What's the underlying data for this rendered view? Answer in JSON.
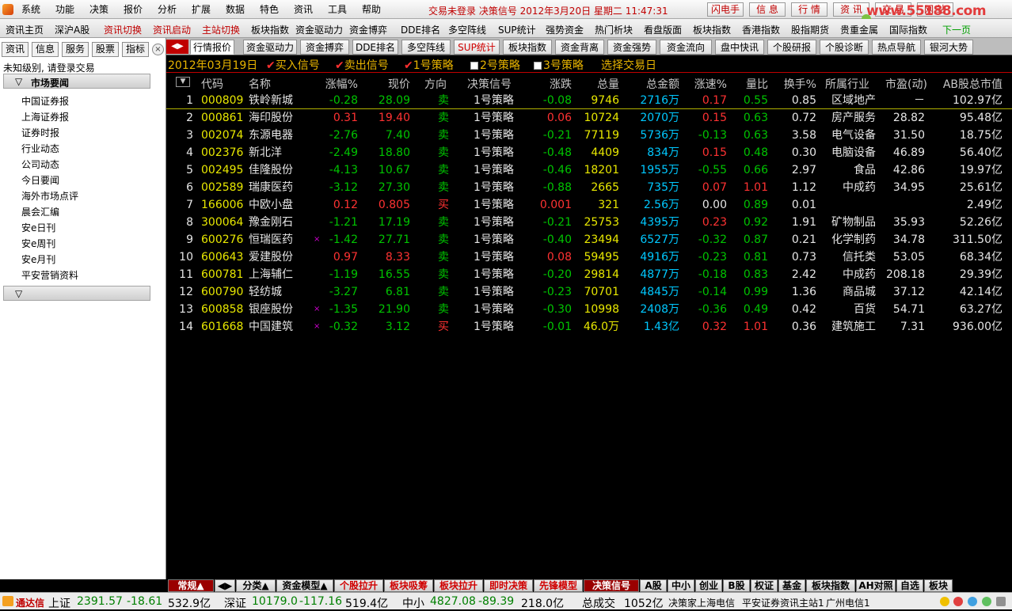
{
  "menu": [
    "系统",
    "功能",
    "决策",
    "报价",
    "分析",
    "扩展",
    "数据",
    "特色",
    "资讯",
    "工具",
    "帮助"
  ],
  "status_text": "交易未登录 决策信号 2012年3月20日 星期二 11:47:31",
  "window_buttons": [
    "闪电手",
    "信 息",
    "行 情",
    "资 讯",
    "交 易",
    "网 站"
  ],
  "watermark": "www.55188.com",
  "toolbar": [
    {
      "label": "资讯主页",
      "color": "#000000"
    },
    {
      "label": "深沪A股",
      "color": "#000000"
    },
    {
      "label": "资讯切换",
      "color": "#c00000"
    },
    {
      "label": "资讯启动",
      "color": "#c00000"
    },
    {
      "label": "主站切换",
      "color": "#c00000"
    },
    {
      "label": "板块指数",
      "color": "#000000"
    },
    {
      "label": "资金驱动力",
      "color": "#000000"
    },
    {
      "label": "资金博弈",
      "color": "#000000"
    },
    {
      "label": "DDE排名",
      "color": "#000000"
    },
    {
      "label": "多空阵线",
      "color": "#000000"
    },
    {
      "label": "SUP统计",
      "color": "#000000"
    },
    {
      "label": "强势资金",
      "color": "#000000"
    },
    {
      "label": "热门析块",
      "color": "#000000"
    },
    {
      "label": "看盘版面",
      "color": "#000000"
    },
    {
      "label": "板块指数",
      "color": "#000000"
    },
    {
      "label": "香港指数",
      "color": "#000000"
    },
    {
      "label": "股指期货",
      "color": "#000000"
    },
    {
      "label": "贵重金属",
      "color": "#000000"
    },
    {
      "label": "国际指数",
      "color": "#000000"
    },
    {
      "label": "下一页",
      "color": "#00a000"
    }
  ],
  "sidebar": {
    "tabs": [
      "资讯",
      "信息",
      "服务",
      "股票",
      "指标"
    ],
    "close": "×",
    "login_text": "未知级别, 请登录交易",
    "section1_arrow": "▽",
    "section1_title": "市场要闻",
    "items": [
      "中国证券报",
      "上海证券报",
      "证券时报",
      "行业动态",
      "公司动态",
      "今日要闻",
      "海外市场点评",
      "晨会汇编",
      "安e日刊",
      "安e周刊",
      "安e月刊",
      "平安营销资料"
    ],
    "section2_arrow": "▽"
  },
  "tabs": {
    "arrows": "◀▶",
    "labels": [
      "行情报价",
      "资金驱动力",
      "资金搏弈",
      "DDE排名",
      "多空阵线",
      "SUP统计",
      "板块指数",
      "资金背离",
      "资金强势",
      "资金流向",
      "盘中快讯",
      "个股研报",
      "个股诊断",
      "热点导航",
      "银河大势"
    ],
    "active_index": 0,
    "red_index": 5
  },
  "filter": {
    "date": "2012年03月19日",
    "buy_signal": "买入信号",
    "sell_signal": "卖出信号",
    "strategy1": "1号策略",
    "strategy2": "2号策略",
    "strategy3": "3号策略",
    "select_day": "选择交易日",
    "check_glyph": "✔"
  },
  "table": {
    "sort_glyph": "▼",
    "columns": [
      "代码",
      "名称",
      "涨幅%",
      "现价",
      "方向",
      "决策信号",
      "涨跌",
      "总量",
      "总金额",
      "涨速%",
      "量比",
      "换手%",
      "所属行业",
      "市盈(动)",
      "AB股总市值"
    ],
    "rows": [
      {
        "n": "1",
        "code": "000809",
        "name": "铁岭新城",
        "mark": "",
        "chg": "-0.28",
        "price": "28.09",
        "dir": "卖",
        "sig": "1号策略",
        "diff": "-0.08",
        "vol": "9746",
        "amt": "2716万",
        "speed": "0.17",
        "lb": "0.55",
        "turn": "0.85",
        "ind": "区域地产",
        "pe": "－",
        "mv": "102.97亿"
      },
      {
        "n": "2",
        "code": "000861",
        "name": "海印股份",
        "mark": "",
        "chg": "0.31",
        "price": "19.40",
        "dir": "卖",
        "sig": "1号策略",
        "diff": "0.06",
        "vol": "10724",
        "amt": "2070万",
        "speed": "0.15",
        "lb": "0.63",
        "turn": "0.72",
        "ind": "房产服务",
        "pe": "28.82",
        "mv": "95.48亿"
      },
      {
        "n": "3",
        "code": "002074",
        "name": "东源电器",
        "mark": "",
        "chg": "-2.76",
        "price": "7.40",
        "dir": "卖",
        "sig": "1号策略",
        "diff": "-0.21",
        "vol": "77119",
        "amt": "5736万",
        "speed": "-0.13",
        "lb": "0.63",
        "turn": "3.58",
        "ind": "电气设备",
        "pe": "31.50",
        "mv": "18.75亿"
      },
      {
        "n": "4",
        "code": "002376",
        "name": "新北洋",
        "mark": "",
        "chg": "-2.49",
        "price": "18.80",
        "dir": "卖",
        "sig": "1号策略",
        "diff": "-0.48",
        "vol": "4409",
        "amt": "834万",
        "speed": "0.15",
        "lb": "0.48",
        "turn": "0.30",
        "ind": "电脑设备",
        "pe": "46.89",
        "mv": "56.40亿"
      },
      {
        "n": "5",
        "code": "002495",
        "name": "佳隆股份",
        "mark": "",
        "chg": "-4.13",
        "price": "10.67",
        "dir": "卖",
        "sig": "1号策略",
        "diff": "-0.46",
        "vol": "18201",
        "amt": "1955万",
        "speed": "-0.55",
        "lb": "0.66",
        "turn": "2.97",
        "ind": "食品",
        "pe": "42.86",
        "mv": "19.97亿"
      },
      {
        "n": "6",
        "code": "002589",
        "name": "瑞康医药",
        "mark": "",
        "chg": "-3.12",
        "price": "27.30",
        "dir": "卖",
        "sig": "1号策略",
        "diff": "-0.88",
        "vol": "2665",
        "amt": "735万",
        "speed": "0.07",
        "lb": "1.01",
        "turn": "1.12",
        "ind": "中成药",
        "pe": "34.95",
        "mv": "25.61亿"
      },
      {
        "n": "7",
        "code": "166006",
        "name": "中欧小盘",
        "mark": "",
        "chg": "0.12",
        "price": "0.805",
        "dir": "买",
        "sig": "1号策略",
        "diff": "0.001",
        "vol": "321",
        "amt": "2.56万",
        "speed": "0.00",
        "lb": "0.89",
        "turn": "0.01",
        "ind": "",
        "pe": "",
        "mv": "2.49亿"
      },
      {
        "n": "8",
        "code": "300064",
        "name": "豫金刚石",
        "mark": "",
        "chg": "-1.21",
        "price": "17.19",
        "dir": "卖",
        "sig": "1号策略",
        "diff": "-0.21",
        "vol": "25753",
        "amt": "4395万",
        "speed": "0.23",
        "lb": "0.92",
        "turn": "1.91",
        "ind": "矿物制品",
        "pe": "35.93",
        "mv": "52.26亿"
      },
      {
        "n": "9",
        "code": "600276",
        "name": "恒瑞医药",
        "mark": "×",
        "chg": "-1.42",
        "price": "27.71",
        "dir": "卖",
        "sig": "1号策略",
        "diff": "-0.40",
        "vol": "23494",
        "amt": "6527万",
        "speed": "-0.32",
        "lb": "0.87",
        "turn": "0.21",
        "ind": "化学制药",
        "pe": "34.78",
        "mv": "311.50亿"
      },
      {
        "n": "10",
        "code": "600643",
        "name": "爱建股份",
        "mark": "",
        "chg": "0.97",
        "price": "8.33",
        "dir": "卖",
        "sig": "1号策略",
        "diff": "0.08",
        "vol": "59495",
        "amt": "4916万",
        "speed": "-0.23",
        "lb": "0.81",
        "turn": "0.73",
        "ind": "信托类",
        "pe": "53.05",
        "mv": "68.34亿"
      },
      {
        "n": "11",
        "code": "600781",
        "name": "上海辅仁",
        "mark": "",
        "chg": "-1.19",
        "price": "16.55",
        "dir": "卖",
        "sig": "1号策略",
        "diff": "-0.20",
        "vol": "29814",
        "amt": "4877万",
        "speed": "-0.18",
        "lb": "0.83",
        "turn": "2.42",
        "ind": "中成药",
        "pe": "208.18",
        "mv": "29.39亿"
      },
      {
        "n": "12",
        "code": "600790",
        "name": "轻纺城",
        "mark": "",
        "chg": "-3.27",
        "price": "6.81",
        "dir": "卖",
        "sig": "1号策略",
        "diff": "-0.23",
        "vol": "70701",
        "amt": "4845万",
        "speed": "-0.14",
        "lb": "0.99",
        "turn": "1.36",
        "ind": "商品城",
        "pe": "37.12",
        "mv": "42.14亿"
      },
      {
        "n": "13",
        "code": "600858",
        "name": "银座股份",
        "mark": "×",
        "chg": "-1.35",
        "price": "21.90",
        "dir": "卖",
        "sig": "1号策略",
        "diff": "-0.30",
        "vol": "10998",
        "amt": "2408万",
        "speed": "-0.36",
        "lb": "0.49",
        "turn": "0.42",
        "ind": "百货",
        "pe": "54.71",
        "mv": "63.27亿"
      },
      {
        "n": "14",
        "code": "601668",
        "name": "中国建筑",
        "mark": "×",
        "chg": "-0.32",
        "price": "3.12",
        "dir": "买",
        "sig": "1号策略",
        "diff": "-0.01",
        "vol": "46.0万",
        "amt": "1.43亿",
        "speed": "0.32",
        "lb": "1.01",
        "turn": "0.36",
        "ind": "建筑施工",
        "pe": "7.31",
        "mv": "936.00亿"
      }
    ]
  },
  "bottom_tabs": [
    {
      "label": "常规▲",
      "red": false,
      "active": true
    },
    {
      "label": "◀▶",
      "red": false,
      "active": false
    },
    {
      "label": "分类▲",
      "red": false,
      "active": false
    },
    {
      "label": "资金模型▲",
      "red": false,
      "active": false
    },
    {
      "label": "个股拉升",
      "red": true,
      "active": false
    },
    {
      "label": "板块吸筹",
      "red": true,
      "active": false
    },
    {
      "label": "板块拉升",
      "red": true,
      "active": false
    },
    {
      "label": "即时决策",
      "red": true,
      "active": false
    },
    {
      "label": "先锋模型",
      "red": true,
      "active": false
    },
    {
      "label": "决策信号",
      "red": false,
      "active": true
    },
    {
      "label": "A股",
      "red": false,
      "active": false
    },
    {
      "label": "中小",
      "red": false,
      "active": false
    },
    {
      "label": "创业",
      "red": false,
      "active": false
    },
    {
      "label": "B股",
      "red": false,
      "active": false
    },
    {
      "label": "权证",
      "red": false,
      "active": false
    },
    {
      "label": "基金",
      "red": false,
      "active": false
    },
    {
      "label": "板块指数",
      "red": false,
      "active": false
    },
    {
      "label": "AH对照",
      "red": false,
      "active": false
    },
    {
      "label": "自选",
      "red": false,
      "active": false
    },
    {
      "label": "板块",
      "red": false,
      "active": false
    }
  ],
  "statusbar": {
    "app": "通达信",
    "sh_label": "上证",
    "sh_index": "2391.57",
    "sh_change": "-18.61",
    "sh_amount": "532.9亿",
    "sz_label": "深证",
    "sz_index": "10179.0",
    "sz_change": "-117.16",
    "sz_amount": "519.4亿",
    "zx_label": "中小",
    "zx_index": "4827.08",
    "zx_change": "-89.39",
    "zx_amount": "218.0亿",
    "total_label": "总成交",
    "total_amount": "1052亿",
    "server": "决策家上海电信",
    "station": "平安证券资讯主站1",
    "isp": "广州电信1"
  }
}
